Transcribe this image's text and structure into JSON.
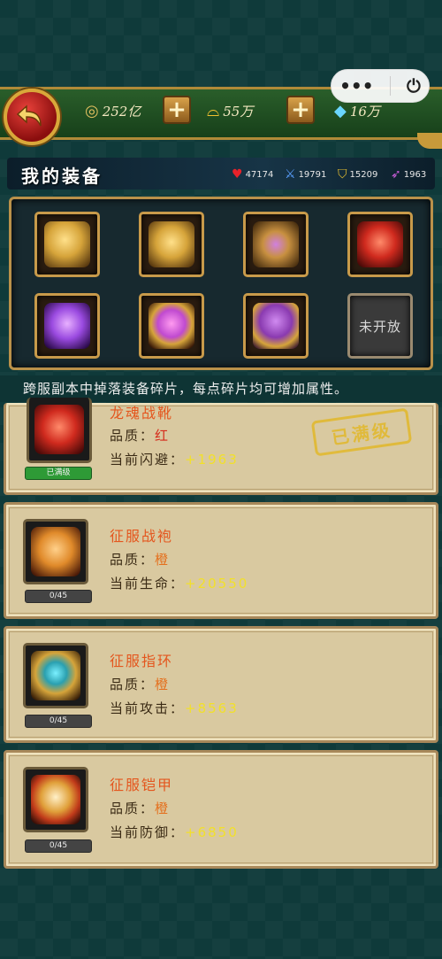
{
  "resources": {
    "coins": "252亿",
    "ingots": "55万",
    "diamonds": "16万"
  },
  "header": {
    "title": "我的装备",
    "stats": [
      {
        "icon": "heart-icon",
        "value": "47174",
        "color": "#e8222a"
      },
      {
        "icon": "sword-icon",
        "value": "19791",
        "color": "#5aa0ff"
      },
      {
        "icon": "shield-icon",
        "value": "15209",
        "color": "#e8c030"
      },
      {
        "icon": "dodge-icon",
        "value": "1963",
        "color": "#d060e0"
      }
    ]
  },
  "equipment_slots": [
    {
      "name": "gold-helmet",
      "color": "#d6a43a",
      "locked": false
    },
    {
      "name": "gold-bracer",
      "color": "#d6a43a",
      "locked": false
    },
    {
      "name": "gold-belt",
      "color": "#c89040",
      "locked": false
    },
    {
      "name": "red-boots",
      "color": "#d02a1e",
      "locked": false
    },
    {
      "name": "purple-armor",
      "color": "#9a4ae0",
      "locked": false
    },
    {
      "name": "purple-ring",
      "color": "#c04ad0",
      "locked": false
    },
    {
      "name": "purple-robe",
      "color": "#8a3ab0",
      "locked": false
    },
    {
      "name": "locked-slot",
      "color": "#555555",
      "locked": true,
      "label": "未开放"
    }
  ],
  "notice": "跨服副本中掉落装备碎片，每点碎片均可增加属性。",
  "items": [
    {
      "name": "龙魂战靴",
      "quality_label": "品质：",
      "quality": "红",
      "stat_label": "当前闪避：",
      "stat_value": "+1963",
      "progress": "已满级",
      "maxed": true,
      "stamp": "已满级",
      "color": "#d02a1e"
    },
    {
      "name": "征服战袍",
      "quality_label": "品质：",
      "quality": "橙",
      "stat_label": "当前生命：",
      "stat_value": "+20550",
      "progress": "0/45",
      "maxed": false,
      "color": "#e08a2a"
    },
    {
      "name": "征服指环",
      "quality_label": "品质：",
      "quality": "橙",
      "stat_label": "当前攻击：",
      "stat_value": "+8563",
      "progress": "0/45",
      "maxed": false,
      "color": "#d6a43a"
    },
    {
      "name": "征服铠甲",
      "quality_label": "品质：",
      "quality": "橙",
      "stat_label": "当前防御：",
      "stat_value": "+6850",
      "progress": "0/45",
      "maxed": false,
      "color": "#e0a03a"
    }
  ]
}
